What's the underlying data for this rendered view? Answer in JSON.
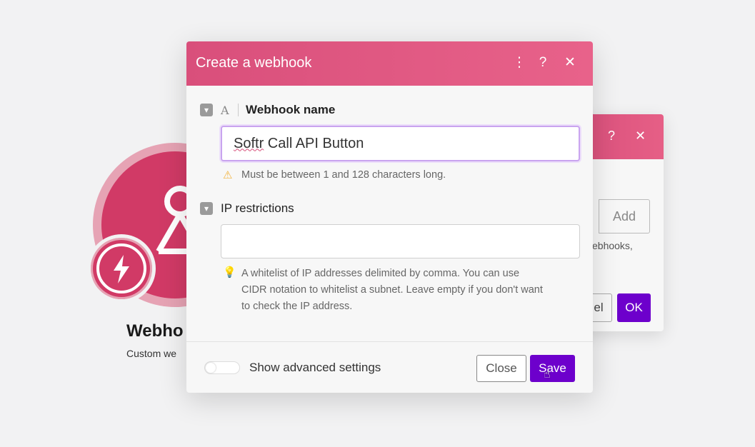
{
  "background": {
    "module_title": "Webho",
    "module_subtitle": "Custom we",
    "accent": "#d13a66"
  },
  "back_dialog": {
    "help_icon": "help-icon",
    "close_icon": "close-icon",
    "add_label": "Add",
    "text_fragment": "ebhooks,",
    "cancel_fragment": "el",
    "ok_label": "OK"
  },
  "dialog": {
    "title": "Create a webhook",
    "menu_icon": "⋮",
    "help_icon": "?",
    "close_icon": "✕",
    "header_color": "#e05a82",
    "fields": {
      "webhook_name": {
        "label": "Webhook name",
        "type_icon": "A",
        "value": "Softr Call API Button",
        "value_first_word": "Softr",
        "value_rest": " Call API Button",
        "hint": "Must be between 1 and 128 characters long.",
        "hint_icon": "warning-icon"
      },
      "ip_restrictions": {
        "label": "IP restrictions",
        "value": "",
        "hint_lines": [
          "A whitelist of IP addresses delimited by comma. You can use",
          "CIDR notation to whitelist a subnet. Leave empty if you don't want",
          "to check the IP address."
        ],
        "hint_icon": "lightbulb-icon"
      }
    },
    "footer": {
      "advanced_label": "Show advanced settings",
      "advanced_enabled": false,
      "close_label": "Close",
      "save_label": "Save"
    },
    "primary_color": "#6d00cc"
  }
}
